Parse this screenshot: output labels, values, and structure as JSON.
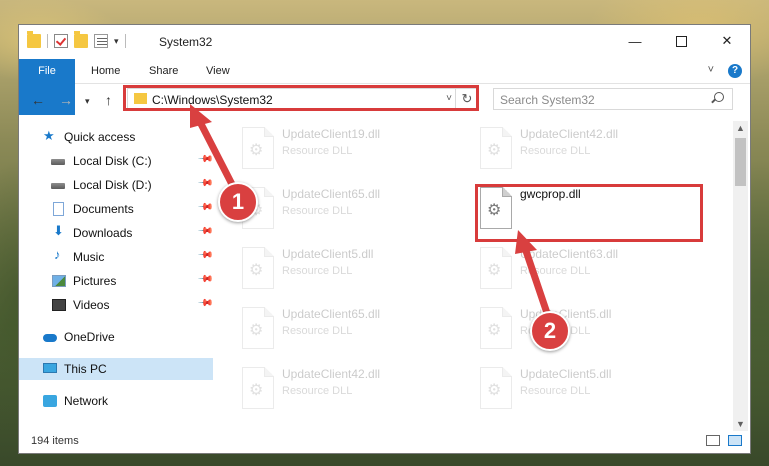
{
  "window": {
    "title": "System32"
  },
  "ribbon": {
    "tabs": [
      "File",
      "Home",
      "Share",
      "View"
    ]
  },
  "address": {
    "path": "C:\\Windows\\System32",
    "search_placeholder": "Search System32"
  },
  "navpane": {
    "items": [
      {
        "label": "Quick access",
        "icon": "star-icon",
        "pinned": false
      },
      {
        "label": "Local Disk (C:)",
        "icon": "drive-icon",
        "pinned": true
      },
      {
        "label": "Local Disk (D:)",
        "icon": "drive-icon",
        "pinned": true
      },
      {
        "label": "Documents",
        "icon": "document-icon",
        "pinned": true
      },
      {
        "label": "Downloads",
        "icon": "download-icon",
        "pinned": true
      },
      {
        "label": "Music",
        "icon": "music-icon",
        "pinned": true
      },
      {
        "label": "Pictures",
        "icon": "pictures-icon",
        "pinned": true
      },
      {
        "label": "Videos",
        "icon": "videos-icon",
        "pinned": true
      },
      {
        "label": "OneDrive",
        "icon": "onedrive-icon",
        "pinned": false
      },
      {
        "label": "This PC",
        "icon": "pc-icon",
        "pinned": false,
        "selected": true
      },
      {
        "label": "Network",
        "icon": "network-icon",
        "pinned": false
      }
    ]
  },
  "files": [
    {
      "name": "UpdateClient19.dll",
      "type": "Resource DLL"
    },
    {
      "name": "UpdateClient42.dll",
      "type": "Resource DLL"
    },
    {
      "name": "UpdateClient65.dll",
      "type": "Resource DLL"
    },
    {
      "name": "gwcprop.dll",
      "type": "",
      "highlighted": true
    },
    {
      "name": "UpdateClient5.dll",
      "type": "Resource DLL"
    },
    {
      "name": "UpdateClient63.dll",
      "type": "Resource DLL"
    },
    {
      "name": "UpdateClient65.dll",
      "type": "Resource DLL"
    },
    {
      "name": "UpdateClient5.dll",
      "type": "Resource DLL"
    },
    {
      "name": "UpdateClient42.dll",
      "type": "Resource DLL"
    },
    {
      "name": "UpdateClient5.dll",
      "type": "Resource DLL"
    }
  ],
  "status": {
    "item_count": "194 items"
  },
  "callouts": {
    "step1": "1",
    "step2": "2"
  },
  "colors": {
    "accent": "#1979ca",
    "highlight": "#d83b3b"
  }
}
